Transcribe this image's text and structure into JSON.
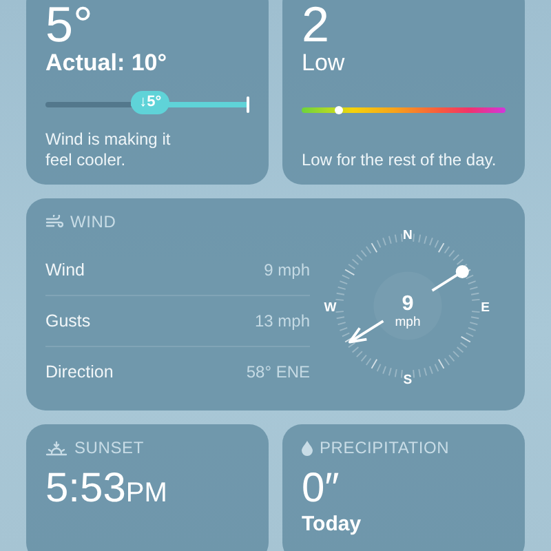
{
  "feels_like": {
    "value": "5°",
    "caption": "Actual: 10°",
    "badge": "↓5°",
    "description": "Wind is making it feel cooler."
  },
  "uv_index": {
    "value": "2",
    "caption": "Low",
    "level": 0.18,
    "description": "Low for the rest of the day."
  },
  "wind": {
    "title": "WIND",
    "rows": [
      {
        "label": "Wind",
        "value": "9 mph"
      },
      {
        "label": "Gusts",
        "value": "13 mph"
      },
      {
        "label": "Direction",
        "value": "58° ENE"
      }
    ],
    "compass": {
      "speed": "9",
      "unit": "mph",
      "north": "N",
      "east": "E",
      "south": "S",
      "west": "W"
    }
  },
  "sunset": {
    "title": "SUNSET",
    "time": "5:53",
    "period": "PM"
  },
  "precipitation": {
    "title": "PRECIPITATION",
    "value": "0″",
    "caption": "Today"
  }
}
